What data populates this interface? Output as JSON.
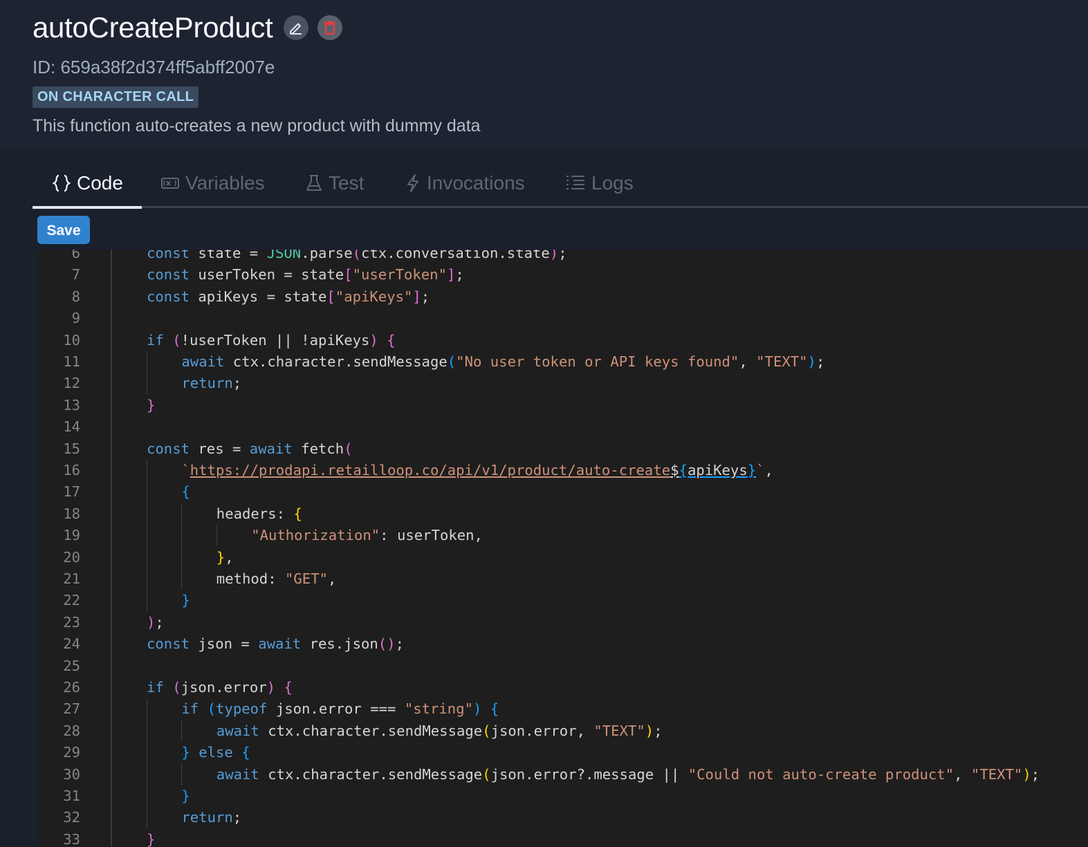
{
  "function": {
    "name": "autoCreateProduct",
    "id_line": "ID: 659a38f2d374ff5abff2007e",
    "badge": "ON CHARACTER CALL",
    "description": "This function auto-creates a new product with dummy data"
  },
  "header_icons": {
    "edit": "edit-pencil-icon",
    "delete": "trash-icon"
  },
  "tabs": [
    {
      "label": "Code",
      "icon": "braces-icon",
      "active": true
    },
    {
      "label": "Variables",
      "icon": "variable-icon",
      "active": false
    },
    {
      "label": "Test",
      "icon": "flask-icon",
      "active": false
    },
    {
      "label": "Invocations",
      "icon": "bolt-icon",
      "active": false
    },
    {
      "label": "Logs",
      "icon": "list-icon",
      "active": false
    }
  ],
  "toolbar": {
    "save_label": "Save"
  },
  "colors": {
    "accent": "#3182ce",
    "keyword": "#569cd6",
    "string": "#ce9178",
    "type": "#4ec9b0",
    "bracket_magenta": "#da70d6",
    "bracket_blue": "#179fff",
    "bracket_yellow": "#ffd700"
  },
  "editor": {
    "lines": [
      {
        "n": "6",
        "text": "const state = JSON.parse(ctx.conversation.state);"
      },
      {
        "n": "7",
        "text": "const userToken = state[\"userToken\"];"
      },
      {
        "n": "8",
        "text": "const apiKeys = state[\"apiKeys\"];"
      },
      {
        "n": "9",
        "text": ""
      },
      {
        "n": "10",
        "text": "if (!userToken || !apiKeys) {"
      },
      {
        "n": "11",
        "text": "await ctx.character.sendMessage(\"No user token or API keys found\", \"TEXT\");"
      },
      {
        "n": "12",
        "text": "return;"
      },
      {
        "n": "13",
        "text": "}"
      },
      {
        "n": "14",
        "text": ""
      },
      {
        "n": "15",
        "text": "const res = await fetch("
      },
      {
        "n": "16",
        "text": "`https://prodapi.retailloop.co/api/v1/product/auto-create${apiKeys}`,"
      },
      {
        "n": "17",
        "text": "{"
      },
      {
        "n": "18",
        "text": "headers: {"
      },
      {
        "n": "19",
        "text": "\"Authorization\": userToken,"
      },
      {
        "n": "20",
        "text": "},"
      },
      {
        "n": "21",
        "text": "method: \"GET\","
      },
      {
        "n": "22",
        "text": "}"
      },
      {
        "n": "23",
        "text": ");"
      },
      {
        "n": "24",
        "text": "const json = await res.json();"
      },
      {
        "n": "25",
        "text": ""
      },
      {
        "n": "26",
        "text": "if (json.error) {"
      },
      {
        "n": "27",
        "text": "if (typeof json.error === \"string\") {"
      },
      {
        "n": "28",
        "text": "await ctx.character.sendMessage(json.error, \"TEXT\");"
      },
      {
        "n": "29",
        "text": "} else {"
      },
      {
        "n": "30",
        "text": "await ctx.character.sendMessage(json.error?.message || \"Could not auto-create product\", \"TEXT\");"
      },
      {
        "n": "31",
        "text": "}"
      },
      {
        "n": "32",
        "text": "return;"
      },
      {
        "n": "33",
        "text": "}"
      }
    ]
  }
}
